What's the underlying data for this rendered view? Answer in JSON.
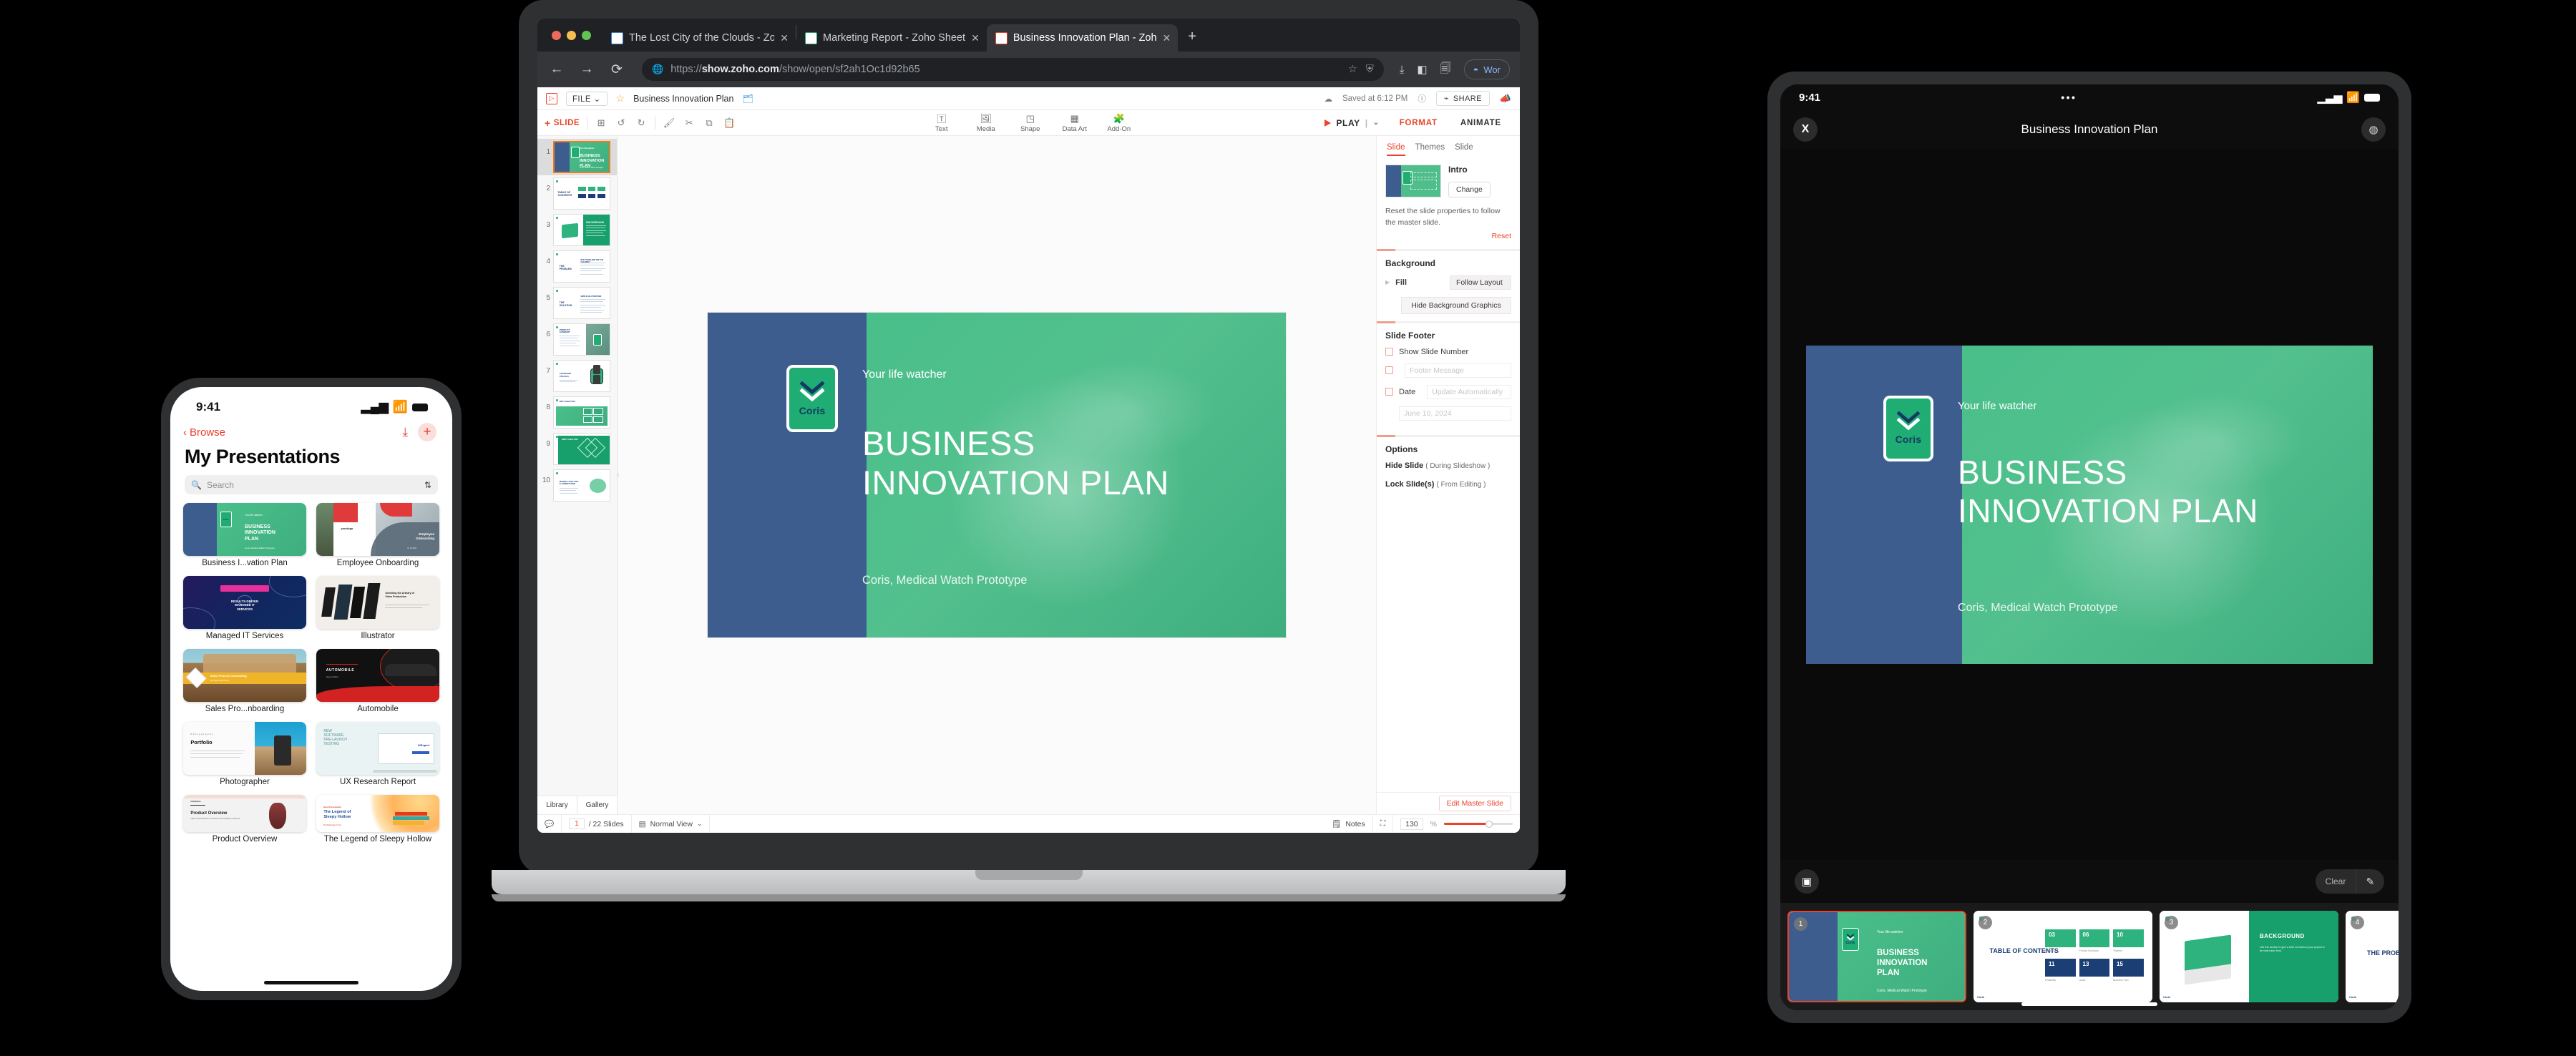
{
  "browser": {
    "tabs": [
      {
        "title": "The Lost City of the Clouds - Zo",
        "close": "✕",
        "icon": "zoho-writer-icon",
        "active": false
      },
      {
        "title": "Marketing Report - Zoho Sheet",
        "close": "✕",
        "icon": "zoho-sheet-icon",
        "active": false
      },
      {
        "title": "Business Innovation Plan - Zoh",
        "close": "✕",
        "icon": "zoho-show-icon",
        "active": true
      }
    ],
    "new_tab": "+",
    "nav": {
      "back": "←",
      "forward": "→",
      "reload": "⟳"
    },
    "url": {
      "scheme": "https://",
      "host": "show.zoho.com",
      "path": "/show/open/sf2ah1Oc1d92b65"
    },
    "url_full": "https://show.zoho.com/show/open/sf2ah1Oc1d92b65",
    "profile_label": "Wor"
  },
  "app": {
    "logo": "▷",
    "file_menu": "FILE",
    "doc_title": "Business Innovation Plan",
    "saved_status": "Saved at 6:12 PM",
    "share_label": "SHARE",
    "slide_button": "SLIDE",
    "tools": [
      {
        "label": "Text",
        "icon": "text-box-icon"
      },
      {
        "label": "Media",
        "icon": "image-icon"
      },
      {
        "label": "Shape",
        "icon": "shape-icon"
      },
      {
        "label": "Data Art",
        "icon": "chart-icon"
      },
      {
        "label": "Add-On",
        "icon": "puzzle-icon"
      }
    ],
    "play_label": "PLAY",
    "right_tabs": [
      {
        "label": "FORMAT",
        "active": true
      },
      {
        "label": "ANIMATE",
        "active": false
      }
    ]
  },
  "thumbnails": {
    "footer": {
      "library": "Library",
      "gallery": "Gallery"
    },
    "items": [
      {
        "num": "1",
        "kind": "title",
        "selected": true
      },
      {
        "num": "2",
        "kind": "toc",
        "title": "TABLE OF CONTENTS"
      },
      {
        "num": "3",
        "kind": "background",
        "title": "BACKGROUND"
      },
      {
        "num": "4",
        "kind": "text-left",
        "title": "THE PROBLEM"
      },
      {
        "num": "5",
        "kind": "text-left",
        "title": "THE SOLUTION"
      },
      {
        "num": "6",
        "kind": "photo-right",
        "title": "PRODUCT SUMMARY"
      },
      {
        "num": "7",
        "kind": "watch",
        "title": "LEVERAGE VISUALS"
      },
      {
        "num": "8",
        "kind": "pest",
        "title": "PEST ANALYSIS"
      },
      {
        "num": "9",
        "kind": "swot",
        "title": "SWOT ANALYSIS"
      },
      {
        "num": "10",
        "kind": "market",
        "title": "MARKET ANALYSIS & COMPETITION"
      }
    ]
  },
  "slide": {
    "logo_text": "Coris",
    "tagline": "Your life watcher",
    "title": "BUSINESS INNOVATION PLAN",
    "subtitle": "Coris, Medical Watch Prototype",
    "colors": {
      "blue": "#3d5d8f",
      "green": "#49bf8a",
      "brand_green": "#1fad74",
      "logo_navy": "#123a63"
    }
  },
  "format_panel": {
    "tabs": [
      {
        "label": "Slide",
        "active": true
      },
      {
        "label": "Themes",
        "active": false
      },
      {
        "label": "Slide",
        "active": false
      }
    ],
    "master_name": "Intro",
    "change_button": "Change",
    "reset_text": "Reset the slide properties to follow the master slide.",
    "reset_link": "Reset",
    "background": {
      "heading": "Background",
      "fill_label": "Fill",
      "fill_value": "Follow Layout",
      "hide_graphics": "Hide Background Graphics"
    },
    "slide_footer": {
      "heading": "Slide Footer",
      "show_slide_number": "Show Slide Number",
      "footer_message_placeholder": "Footer Message",
      "date_label": "Date",
      "date_mode": "Update Automatically",
      "date_value": "June 10, 2024"
    },
    "options": {
      "heading": "Options",
      "hide_slide": "Hide Slide",
      "hide_slide_note": "( During Slideshow )",
      "lock_slide": "Lock Slide(s)",
      "lock_slide_note": "( From Editing )"
    },
    "edit_master": "Edit Master Slide"
  },
  "status_bar": {
    "notes": "Notes",
    "page_current": "1",
    "page_total": "/ 22 Slides",
    "view_mode": "Normal View",
    "zoom_value": "130",
    "zoom_unit": "%"
  },
  "phone": {
    "status": {
      "time": "9:41",
      "signal": "signal-icon",
      "wifi": "wifi-icon",
      "battery": "battery-icon"
    },
    "back_label": "Browse",
    "download_icon": "download-icon",
    "add_icon": "plus-icon",
    "title": "My Presentations",
    "search_placeholder": "Search",
    "sort_icon": "sort-icon",
    "cards": [
      {
        "name": "Business I...vation Plan",
        "kind": "title"
      },
      {
        "name": "Employee Onboarding",
        "kind": "onboarding"
      },
      {
        "name": "Managed IT Services",
        "kind": "managed-it"
      },
      {
        "name": "Illustrator",
        "kind": "illustrator"
      },
      {
        "name": "Sales Pro...nboarding",
        "kind": "sales"
      },
      {
        "name": "Automobile",
        "kind": "automobile"
      },
      {
        "name": "Photographer",
        "kind": "photographer"
      },
      {
        "name": "UX Research Report",
        "kind": "ux"
      },
      {
        "name": "Product Overview",
        "kind": "product"
      },
      {
        "name": "The Legend of Sleepy Hollow",
        "kind": "legend"
      }
    ],
    "card_inner": {
      "onboarding_logo": "yourlogo",
      "onboarding_title": "Employee Onboarding",
      "onboarding_date": "07.12.2021",
      "managed_title": "RESULTS-DRIVEN MANAGED IT SERVICES",
      "illustrator_title": "Unveiling the Artistry of Video Production",
      "sales_title": "Sales Process Onboarding",
      "sales_sub": "New Sales Rep Training",
      "automobile_title": "AUTOMOBILE",
      "automobile_sub": "Newest Addition",
      "photographer_kicker": "Photography",
      "photographer_title": "Portfolio",
      "ux_title": "NEW SOFTWARE PRE-LAUNCH TESTING",
      "ux_brand": "UiExpert",
      "product_title": "Product Overview",
      "product_sub": "KEEP THINGS SIMPLE TO MAKE YOUR AUDIENCE CURIOUS",
      "legend_kicker": "Book Presentation",
      "legend_title": "The Legend of Sleepy Hollow",
      "legend_author": "By Washington Irving"
    }
  },
  "tablet": {
    "status": {
      "time": "9:41",
      "dots": "•••",
      "signal": "signal-icon",
      "wifi": "wifi-icon",
      "battery": "battery-icon"
    },
    "close_label": "X",
    "title": "Business Innovation Plan",
    "cast_icon": "cast-icon",
    "screen_icon": "present-screen-icon",
    "clear_label": "Clear",
    "pen_icon": "pencil-icon",
    "filmstrip": [
      {
        "num": "1",
        "kind": "title",
        "selected": true
      },
      {
        "num": "2",
        "kind": "toc",
        "title": "TABLE OF CONTENTS",
        "cells": [
          {
            "n": "03",
            "label": "Background",
            "tone": "green"
          },
          {
            "n": "06",
            "label": "Product Summary",
            "tone": "green"
          },
          {
            "n": "10",
            "label": "Timeline",
            "tone": "green"
          },
          {
            "n": "11",
            "label": "Feasibility",
            "tone": "blue"
          },
          {
            "n": "13",
            "label": "Goals",
            "tone": "blue"
          },
          {
            "n": "15",
            "label": "Business Plan",
            "tone": "blue"
          }
        ]
      },
      {
        "num": "3",
        "kind": "background",
        "title": "BACKGROUND",
        "body": "Use this section to give a brief overview of your project in its most basic form."
      },
      {
        "num": "4",
        "kind": "problem",
        "title": "THE PROBLEM"
      }
    ],
    "footer_brand": "Coris"
  }
}
